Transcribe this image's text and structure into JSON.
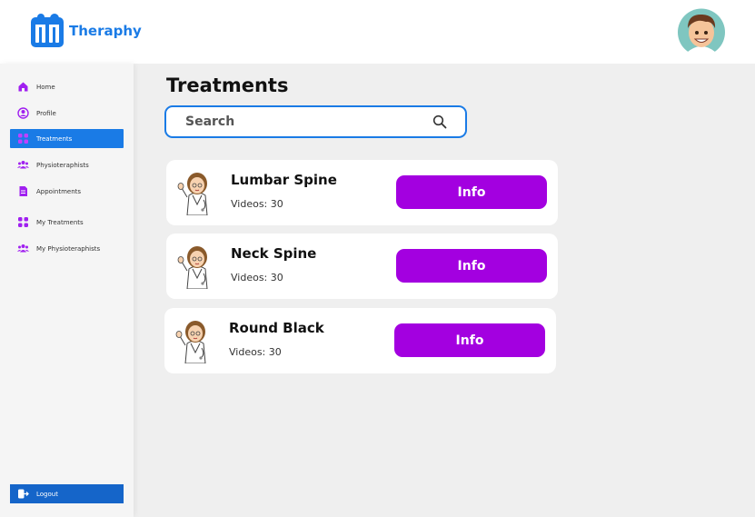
{
  "app": {
    "name": "Theraphy"
  },
  "sidebar": {
    "items": [
      {
        "label": "Home",
        "icon": "home-icon"
      },
      {
        "label": "Profile",
        "icon": "user-circle-icon"
      },
      {
        "label": "Treatments",
        "icon": "grid-icon"
      },
      {
        "label": "Physioteraphists",
        "icon": "users-icon"
      },
      {
        "label": "Appointments",
        "icon": "document-icon"
      },
      {
        "label": "My Treatments",
        "icon": "grid-icon"
      },
      {
        "label": "My Physioteraphists",
        "icon": "users-icon"
      }
    ],
    "active": "Treatments",
    "logout_label": "Logout"
  },
  "main": {
    "title": "Treatments",
    "search": {
      "placeholder": "Search",
      "value": ""
    },
    "cards": [
      {
        "title": "Lumbar Spine",
        "videos": "Videos: 30",
        "button": "Info"
      },
      {
        "title": "Neck Spine",
        "videos": "Videos: 30",
        "button": "Info"
      },
      {
        "title": "Round Black",
        "videos": "Videos: 30",
        "button": "Info"
      }
    ]
  },
  "colors": {
    "accent_blue": "#1a7be6",
    "button_purple": "#a300e0",
    "icon_purple": "#a020f0",
    "background": "#efefef"
  }
}
